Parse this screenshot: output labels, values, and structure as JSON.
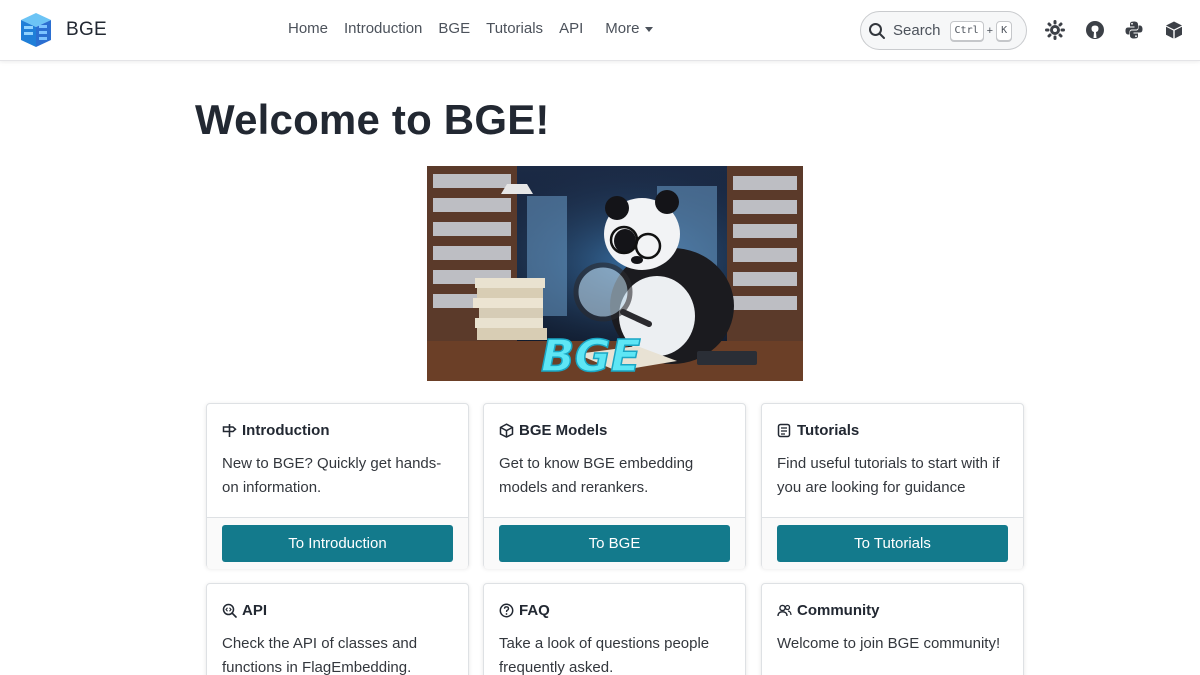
{
  "brand": {
    "name": "BGE"
  },
  "nav": {
    "links": [
      "Home",
      "Introduction",
      "BGE",
      "Tutorials",
      "API"
    ],
    "more": "More"
  },
  "search": {
    "label": "Search",
    "key1": "Ctrl",
    "plus": "+",
    "key2": "K"
  },
  "header_icons": [
    "theme-toggle-icon",
    "github-icon",
    "python-icon",
    "package-icon"
  ],
  "page": {
    "title": "Welcome to BGE!"
  },
  "hero": {
    "label": "BGE"
  },
  "cards": [
    {
      "icon": "signpost-icon",
      "title": "Introduction",
      "text": "New to BGE? Quickly get hands-on information.",
      "button": "To Introduction"
    },
    {
      "icon": "cube-icon",
      "title": "BGE Models",
      "text": "Get to know BGE embedding models and rerankers.",
      "button": "To BGE"
    },
    {
      "icon": "scroll-icon",
      "title": "Tutorials",
      "text": "Find useful tutorials to start with if you are looking for guidance",
      "button": "To Tutorials"
    },
    {
      "icon": "search-code-icon",
      "title": "API",
      "text": "Check the API of classes and functions in FlagEmbedding."
    },
    {
      "icon": "question-icon",
      "title": "FAQ",
      "text": "Take a look of questions people frequently asked."
    },
    {
      "icon": "community-icon",
      "title": "Community",
      "text": "Welcome to join BGE community!"
    }
  ],
  "colors": {
    "accent": "#137a8c",
    "text": "#222832",
    "nav": "#4c525b"
  }
}
